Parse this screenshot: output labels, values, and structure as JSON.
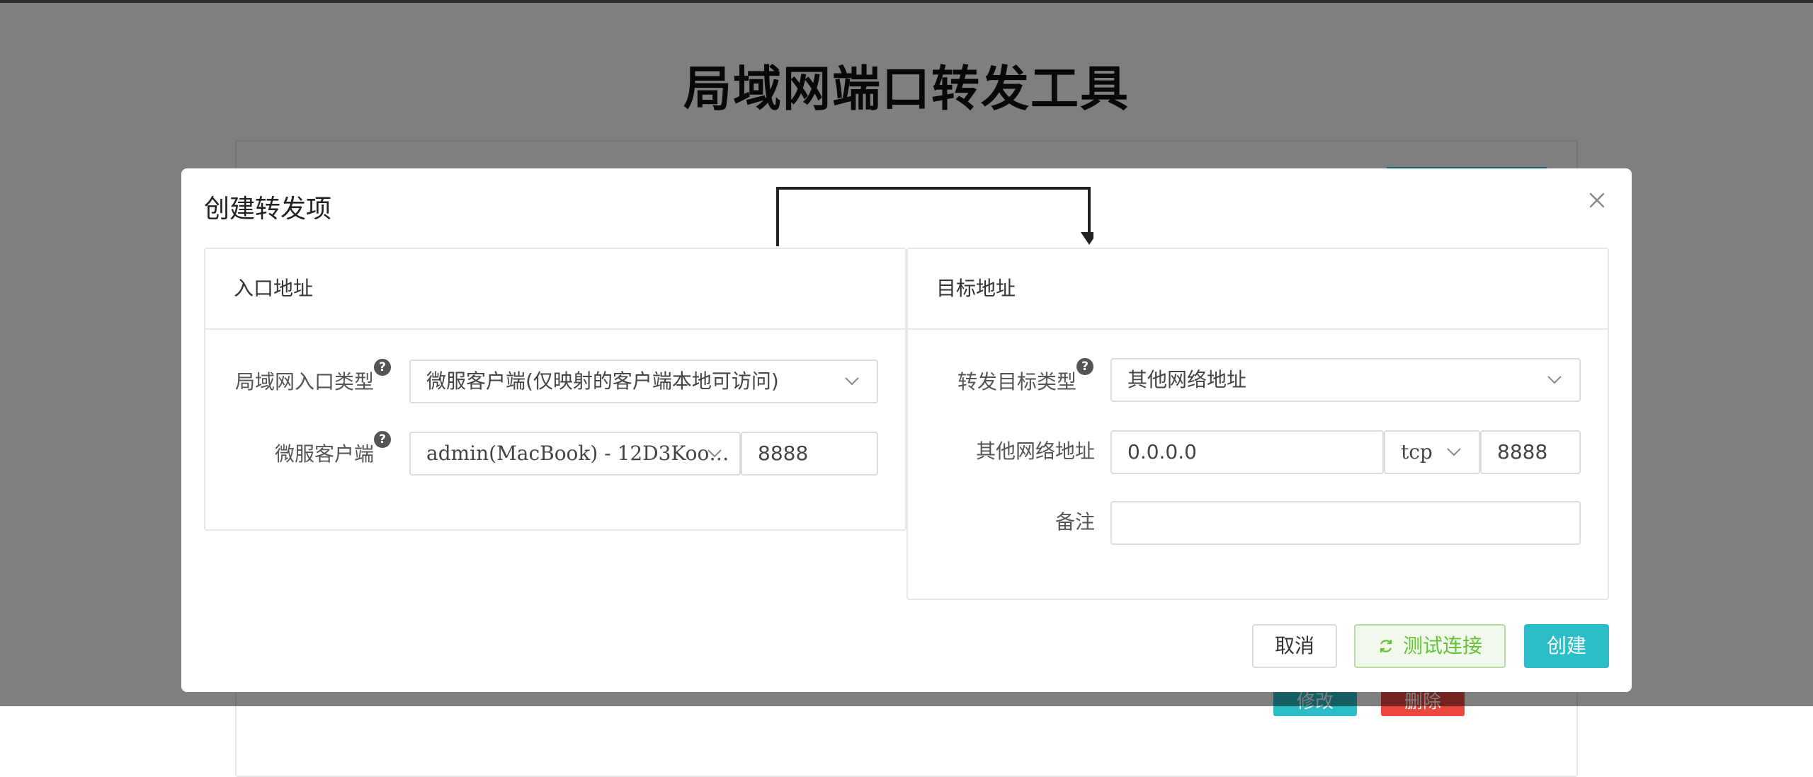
{
  "page": {
    "title": "局域网端口转发工具"
  },
  "background": {
    "edit_label": "修改",
    "delete_label": "删除"
  },
  "modal": {
    "title": "创建转发项",
    "close_icon": "close-icon",
    "entry": {
      "header": "入口地址",
      "type_label": "局域网入口类型",
      "type_value": "微服客户端(仅映射的客户端本地可访问)",
      "client_label": "微服客户端",
      "client_value": "admin(MacBook) - 12D3Koo…",
      "port_value": "8888"
    },
    "target": {
      "header": "目标地址",
      "type_label": "转发目标类型",
      "type_value": "其他网络地址",
      "address_label": "其他网络地址",
      "address_value": "0.0.0.0",
      "protocol_value": "tcp",
      "port_value": "8888",
      "note_label": "备注",
      "note_value": ""
    },
    "buttons": {
      "cancel": "取消",
      "test": "测试连接",
      "create": "创建"
    }
  },
  "colors": {
    "accent": "#2bbec8",
    "success": "#67c23a",
    "danger": "#e9473f"
  }
}
